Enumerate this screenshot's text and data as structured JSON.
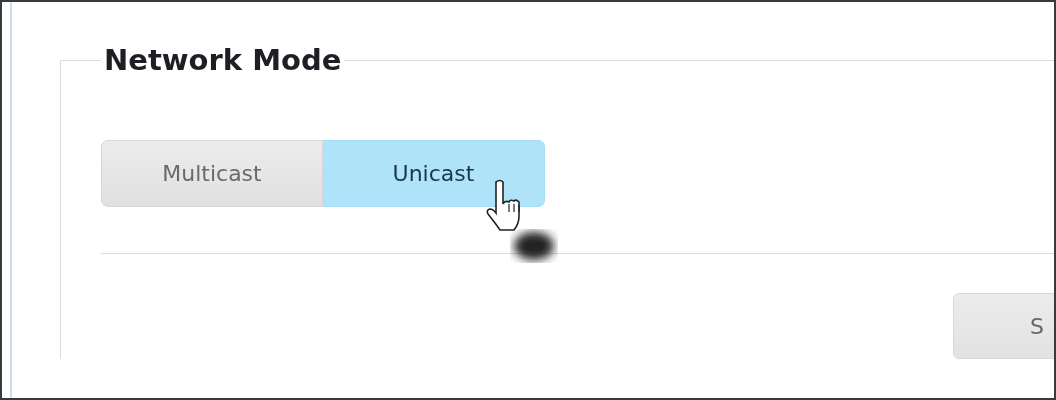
{
  "section": {
    "title": "Network Mode"
  },
  "mode_options": [
    {
      "label": "Multicast",
      "selected": false
    },
    {
      "label": "Unicast",
      "selected": true
    }
  ],
  "buttons": [
    {
      "label": "S"
    }
  ]
}
